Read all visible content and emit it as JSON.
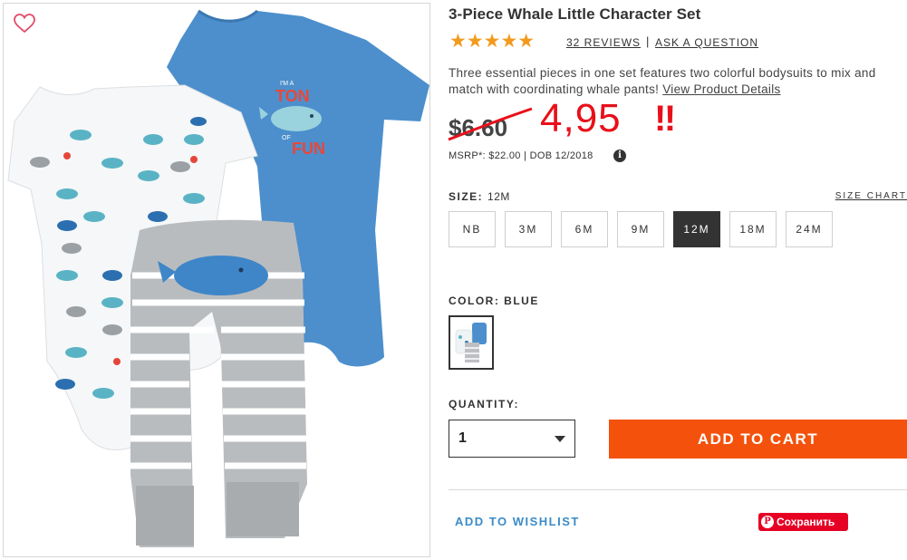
{
  "product": {
    "title": "3-Piece Whale Little Character Set",
    "stars": "★★★★★",
    "rating": 5,
    "reviews_link": "32 REVIEWS",
    "separator": "|",
    "ask_question": "ASK A QUESTION",
    "description": "Three essential pieces in one set features two colorful bodysuits to mix and match with coordinating whale pants!",
    "view_details": "View Product Details"
  },
  "price": {
    "old": "$6.60",
    "new": "4,95",
    "exclaim": "‼",
    "msrp": "MSRP*: $22.00 | DOB 12/2018",
    "info_icon": "i",
    "accent_color": "#e8101a"
  },
  "bodysuit_print": {
    "line1": "I'M A",
    "line2": "TON",
    "line3": "OF",
    "line4": "FUN"
  },
  "size": {
    "label": "SIZE:",
    "selected": "12M",
    "chart_link": "SIZE CHART",
    "options": [
      "NB",
      "3M",
      "6M",
      "9M",
      "12M",
      "18M",
      "24M"
    ]
  },
  "color": {
    "label": "COLOR: BLUE"
  },
  "quantity": {
    "label": "QUANTITY:",
    "value": "1"
  },
  "actions": {
    "add_to_cart": "ADD TO CART",
    "add_to_cart_color": "#f4520c",
    "wishlist": "ADD TO WISHLIST",
    "pinterest_save": "Сохранить",
    "pinterest_icon": "P"
  },
  "icons": {
    "favorite": "heart-outline-icon",
    "dropdown": "chevron-down-icon"
  }
}
